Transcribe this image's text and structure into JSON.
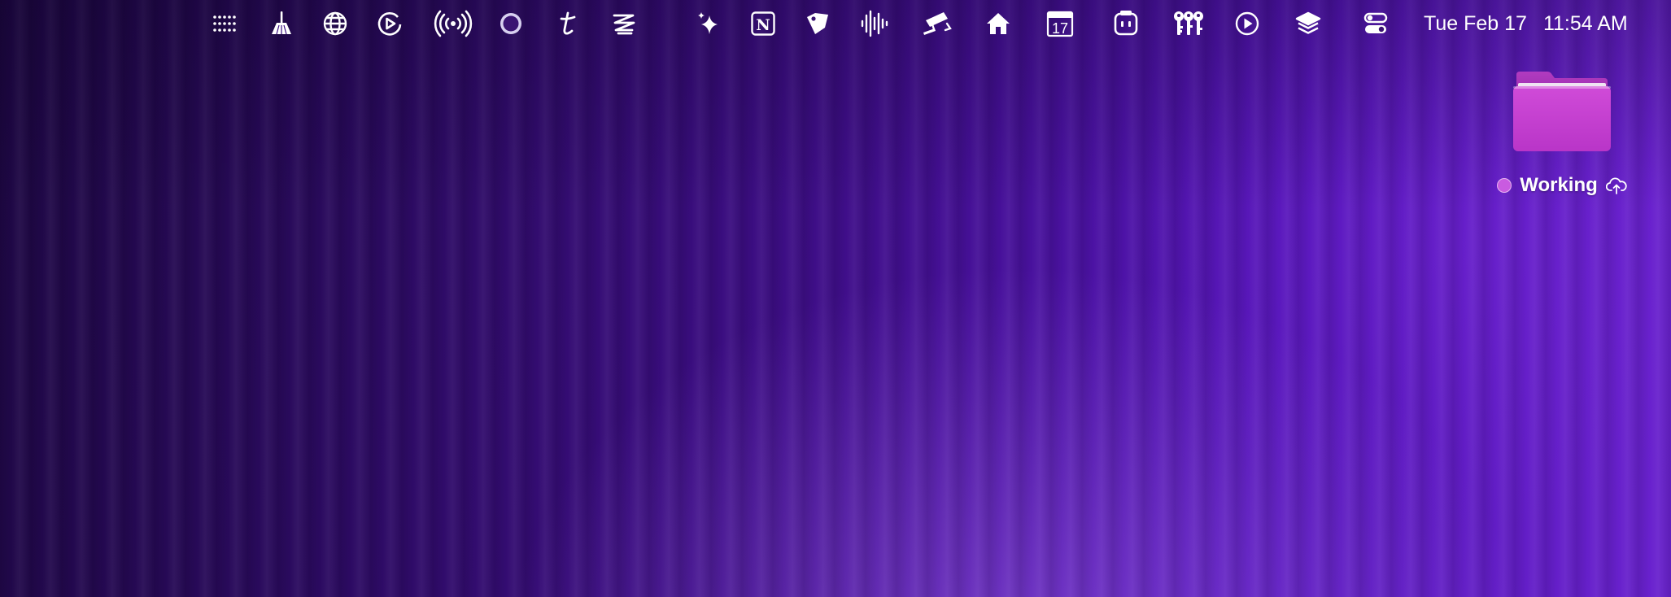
{
  "menubar": {
    "icons": [
      {
        "name": "launcher-grid-icon"
      },
      {
        "name": "broom-cleaner-icon"
      },
      {
        "name": "globe-network-icon"
      },
      {
        "name": "play-circle-replay-icon"
      },
      {
        "name": "broadcast-antenna-icon"
      },
      {
        "name": "ring-circle-icon"
      },
      {
        "name": "t-app-icon"
      },
      {
        "name": "zigzag-lines-icon"
      },
      {
        "name": "sparkles-icon"
      },
      {
        "name": "notion-icon"
      },
      {
        "name": "tag-label-icon"
      },
      {
        "name": "audio-waveform-icon"
      },
      {
        "name": "security-camera-icon"
      },
      {
        "name": "home-icon"
      },
      {
        "name": "calendar-icon"
      },
      {
        "name": "robot-face-icon"
      },
      {
        "name": "keys-icon"
      },
      {
        "name": "play-button-icon"
      },
      {
        "name": "layers-stack-icon"
      },
      {
        "name": "control-center-icon"
      }
    ],
    "calendar_day": "17",
    "notion_letter": "N",
    "date": "Tue Feb 17",
    "time": "11:54 AM"
  },
  "desktop": {
    "folder_label": "Working",
    "folder_color": "#c53fcf",
    "tag_color": "#c95be0"
  }
}
